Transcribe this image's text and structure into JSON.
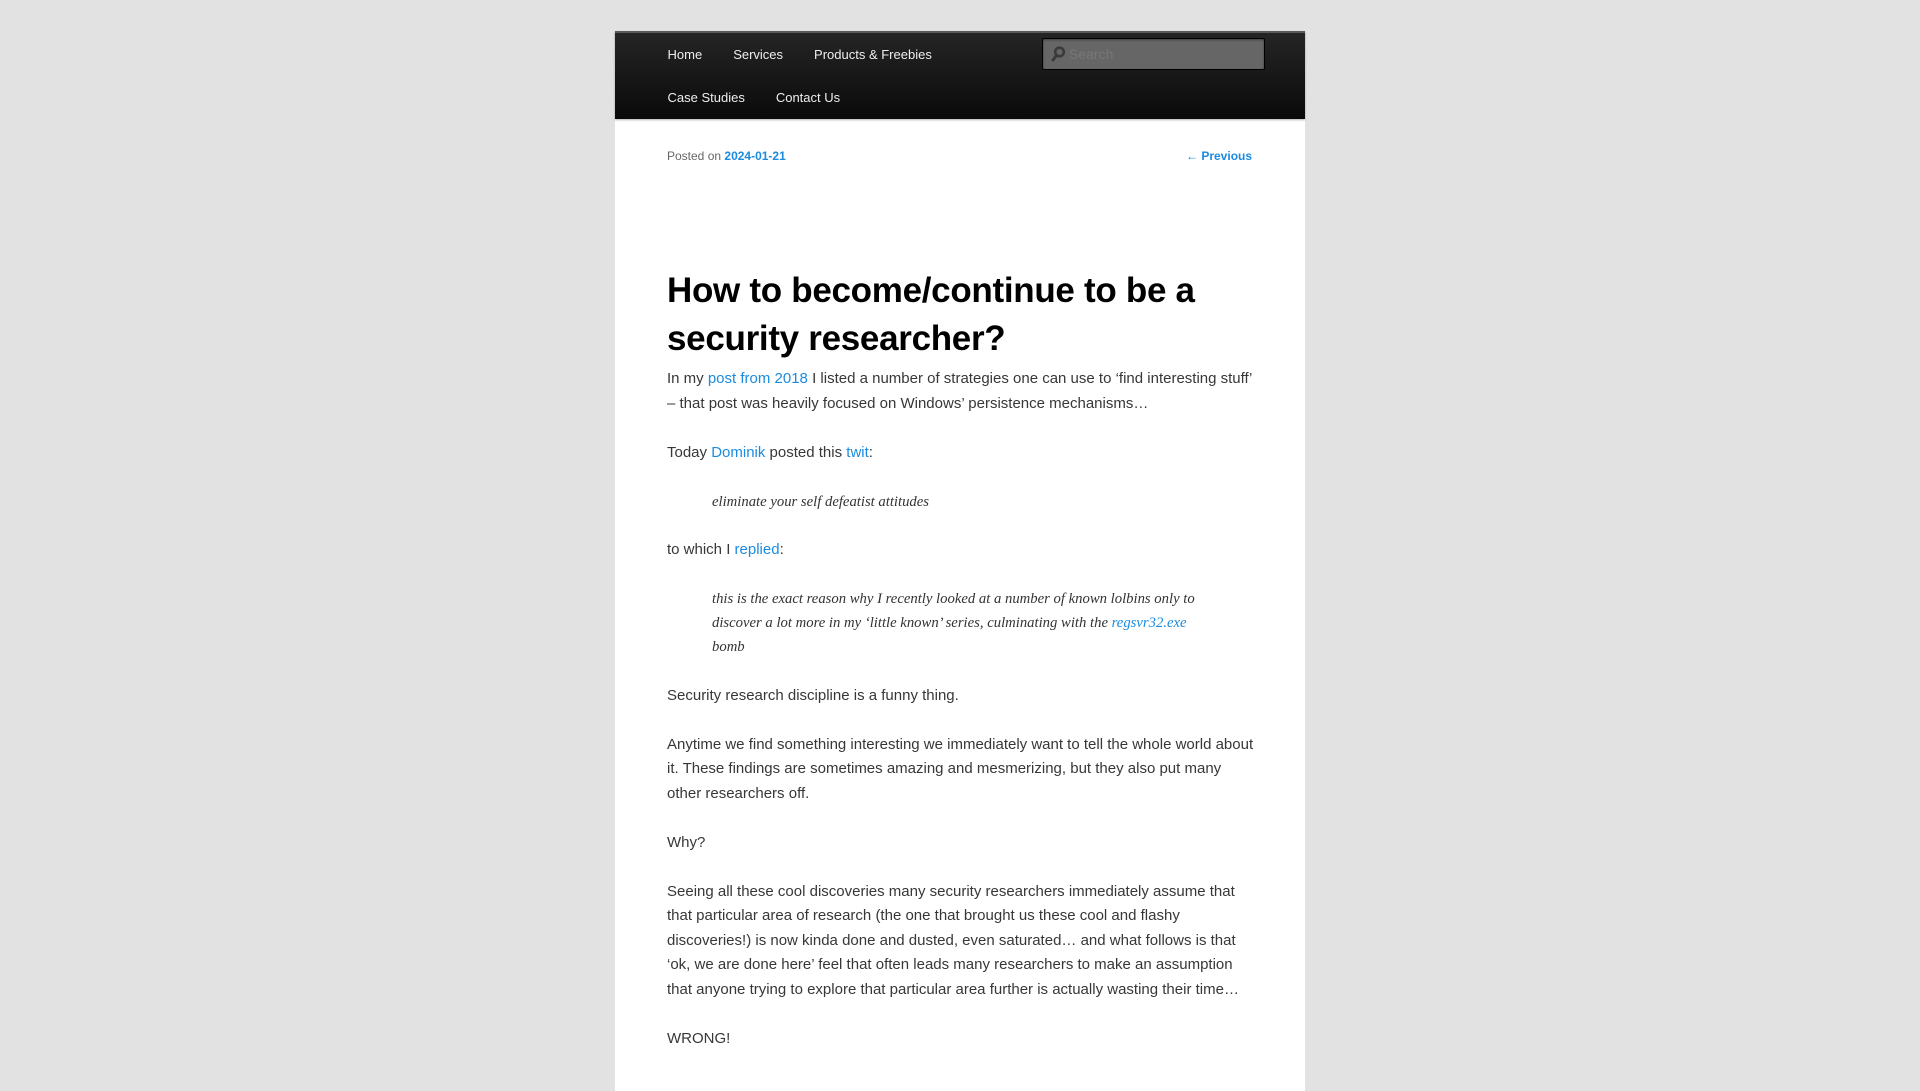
{
  "nav": {
    "items_row1": [
      "Home",
      "Services",
      "Products & Freebies"
    ],
    "items_row2": [
      "Case Studies",
      "Contact Us"
    ],
    "search": {
      "placeholder": "Search",
      "value": "",
      "icon": "search-icon"
    }
  },
  "post": {
    "posted_on_label": "Posted on",
    "date": "2024-01-21",
    "previous_label": "← Previous",
    "title": "How to become/continue to be a security researcher?",
    "p1": {
      "before": "In my ",
      "link": "post from 2018",
      "after": " I listed a number of strategies one can use to ‘find interesting stuff’ – that post was heavily focused on Windows’ persistence mechanisms…"
    },
    "p2": {
      "before": "Today ",
      "link1": "Dominik",
      "middle": " posted this ",
      "link2": "twit",
      "after": ":"
    },
    "quote1": "eliminate your self defeatist attitudes",
    "p3": {
      "before": "to which I ",
      "link": "replied",
      "after": ":"
    },
    "quote2": {
      "before": "this is the exact reason why I recently looked at a number of known lolbins only to discover a lot more in my ‘little known’ series, culminating with the ",
      "link": "regsvr32.exe",
      "after": " bomb"
    },
    "p4": "Security research discipline is a funny thing.",
    "p5": "Anytime we find something interesting we immediately want to tell the whole world about it. These findings are sometimes amazing and mesmerizing, but they also put many other researchers off.",
    "p6": "Why?",
    "p7": "Seeing all these cool discoveries many security researchers immediately assume that that particular area of research (the one that brought us these cool and flashy discoveries!) is now kinda done and dusted, even saturated… and what follows is that ‘ok, we are done here’ feel that often leads many researchers to make an assumption that anyone trying to explore that particular area further is actually wasting their time…",
    "p8": "WRONG!"
  }
}
